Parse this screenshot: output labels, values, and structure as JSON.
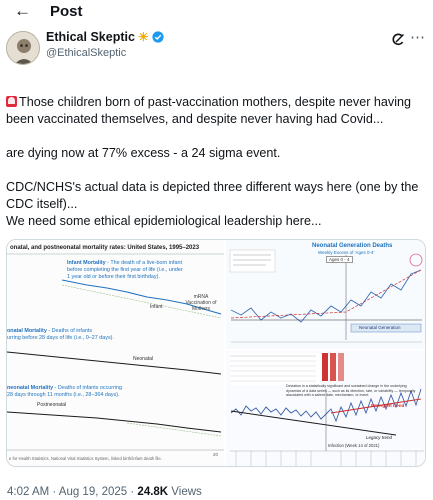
{
  "topbar": {
    "back_icon": "back-arrow-icon",
    "title": "Post"
  },
  "author": {
    "name": "Ethical Skeptic",
    "name_emoji": "☀",
    "handle": "@EthicalSkeptic",
    "verified_color": "#1d9bf0"
  },
  "post": {
    "para1_line1": "Those children born of past-vaccination mothers, despite never having",
    "para1_line2": "been vaccinated themselves, and despite never having had Covid...",
    "para2": "are dying now at 77% excess - a 24 sigma event.",
    "para3_line1": "CDC/NCHS's actual data is depicted three different ways here (one by the",
    "para3_line2": "CDC itself)...",
    "para4": "We need some ethical epidemiological leadership here..."
  },
  "media": {
    "left_chart": {
      "title": "onatal, and postneonatal mortality rates: United States, 1995–2023",
      "infant_label": "Infant Mortality",
      "infant_desc1": " - The death of a live-born infant",
      "infant_desc2": "before completing the first year of life (i.e., under",
      "infant_desc3": "1 year old or before their first birthday).",
      "infant_series": "Infant",
      "mrna_label": "mRNA Vaccination of Mothers",
      "neonatal_label": "onatal Mortality",
      "neonatal_desc1": " - Deaths of infants",
      "neonatal_desc2": "urring before 28 days of life (i.e., 0–27 days).",
      "neonatal_series": "Neonatal",
      "postneonatal_label": "neonatal Mortality",
      "postneonatal_desc1": " - Deaths of infants occurring",
      "postneonatal_desc2": "28 days through 11 months (i.e., 28–364 days).",
      "postneonatal_series": "Postneonatal",
      "source": "e for Health Statistics, National Vital Statistics System, linked birth/infant death file.",
      "x_last": "20"
    },
    "right_top_chart": {
      "title": "Neonatal Generation Deaths",
      "subtitle": "Weekly Excess of 'Ages 0-4'",
      "agegroup": "Ages 0 - 4",
      "annotation": "Neonatal Generation"
    },
    "right_bottom_chart": {
      "desc1": "Deviation in a statistically significant and sustained change in the underlying",
      "desc2": "dynamics of a data series — such as its direction, rate, or variability — temporally",
      "desc3": "associated with a salient date, mechanism, or event.",
      "emergent": "Emergent trend",
      "legacy": "Legacy trend",
      "infection": "Infection (Week 14 of 2021)"
    }
  },
  "footer": {
    "time": "4:02 AM · Aug 19, 2025 · ",
    "views": "24.8K",
    "views_label": " Views"
  }
}
